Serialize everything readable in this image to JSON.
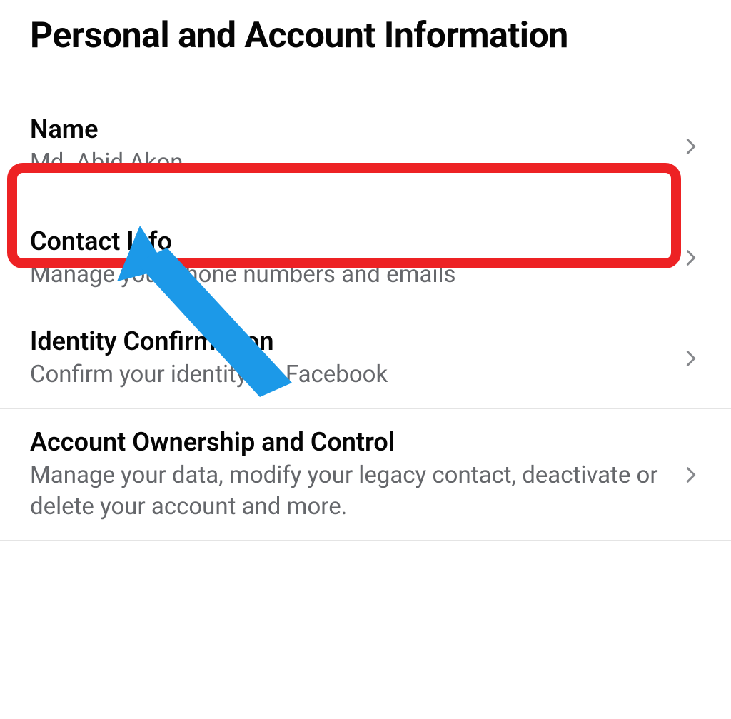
{
  "header": {
    "title": "Personal and Account Information"
  },
  "settings": [
    {
      "label": "Name",
      "subtext": "Md. Abid Akon",
      "name": "name-item"
    },
    {
      "label": "Contact Info",
      "subtext": "Manage your phone numbers and emails",
      "name": "contact-info-item"
    },
    {
      "label": "Identity Confirmation",
      "subtext": "Confirm your identity on Facebook",
      "name": "identity-confirmation-item"
    },
    {
      "label": "Account Ownership and Control",
      "subtext": "Manage your data, modify your legacy contact, deactivate or delete your account and more.",
      "name": "account-ownership-item"
    }
  ],
  "annotation": {
    "highlight_color": "#ed2224",
    "arrow_color": "#1c99e8"
  }
}
